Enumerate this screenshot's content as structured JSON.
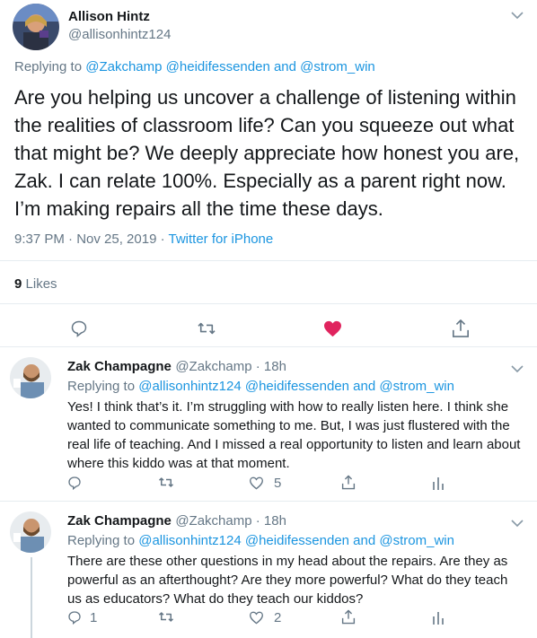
{
  "main_tweet": {
    "author_name": "Allison Hintz",
    "author_handle": "@allisonhintz124",
    "replying_prefix": "Replying to",
    "replying_to": [
      "@Zakchamp",
      "@heidifessenden",
      "@strom_win"
    ],
    "replying_and": "and",
    "text": "Are you helping us uncover a challenge of listening within the realities of classroom life? Can you squeeze out what that might be? We deeply appreciate how honest you are, Zak. I can relate 100%. Especially as a parent right now. I’m making repairs all the time these days.",
    "time": "9:37 PM · Nov 25, 2019 ·",
    "source": "Twitter for iPhone",
    "likes_count": "9",
    "likes_label": "Likes",
    "liked": true
  },
  "replies": [
    {
      "author_name": "Zak Champagne",
      "author_handle": "@Zakchamp · 18h",
      "replying_prefix": "Replying to",
      "replying_to": [
        "@allisonhintz124",
        "@heidifessenden",
        "@strom_win"
      ],
      "replying_and": "and",
      "text": "Yes! I think that’s it. I’m struggling with how to really listen here. I think she wanted to communicate something to me. But, I was just flustered with the real life of teaching. And I missed a real opportunity to listen and learn about where this kiddo was at that moment.",
      "reply_count": "",
      "retweet_count": "",
      "like_count": "5"
    },
    {
      "author_name": "Zak Champagne",
      "author_handle": "@Zakchamp · 18h",
      "replying_prefix": "Replying to",
      "replying_to": [
        "@allisonhintz124",
        "@heidifessenden",
        "@strom_win"
      ],
      "replying_and": "and",
      "text": "There are these other questions in my head about the repairs. Are they as powerful as an afterthought? Are they more powerful? What do they teach us as educators? What do they teach our kiddos?",
      "reply_count": "1",
      "retweet_count": "",
      "like_count": "2"
    }
  ],
  "colors": {
    "accent": "#1b95e0",
    "like_red": "#e0245e",
    "muted": "#657786",
    "border": "#e6ecf0"
  },
  "icons": [
    "reply-icon",
    "retweet-icon",
    "heart-icon",
    "share-icon",
    "analytics-icon",
    "chevron-down-icon"
  ]
}
